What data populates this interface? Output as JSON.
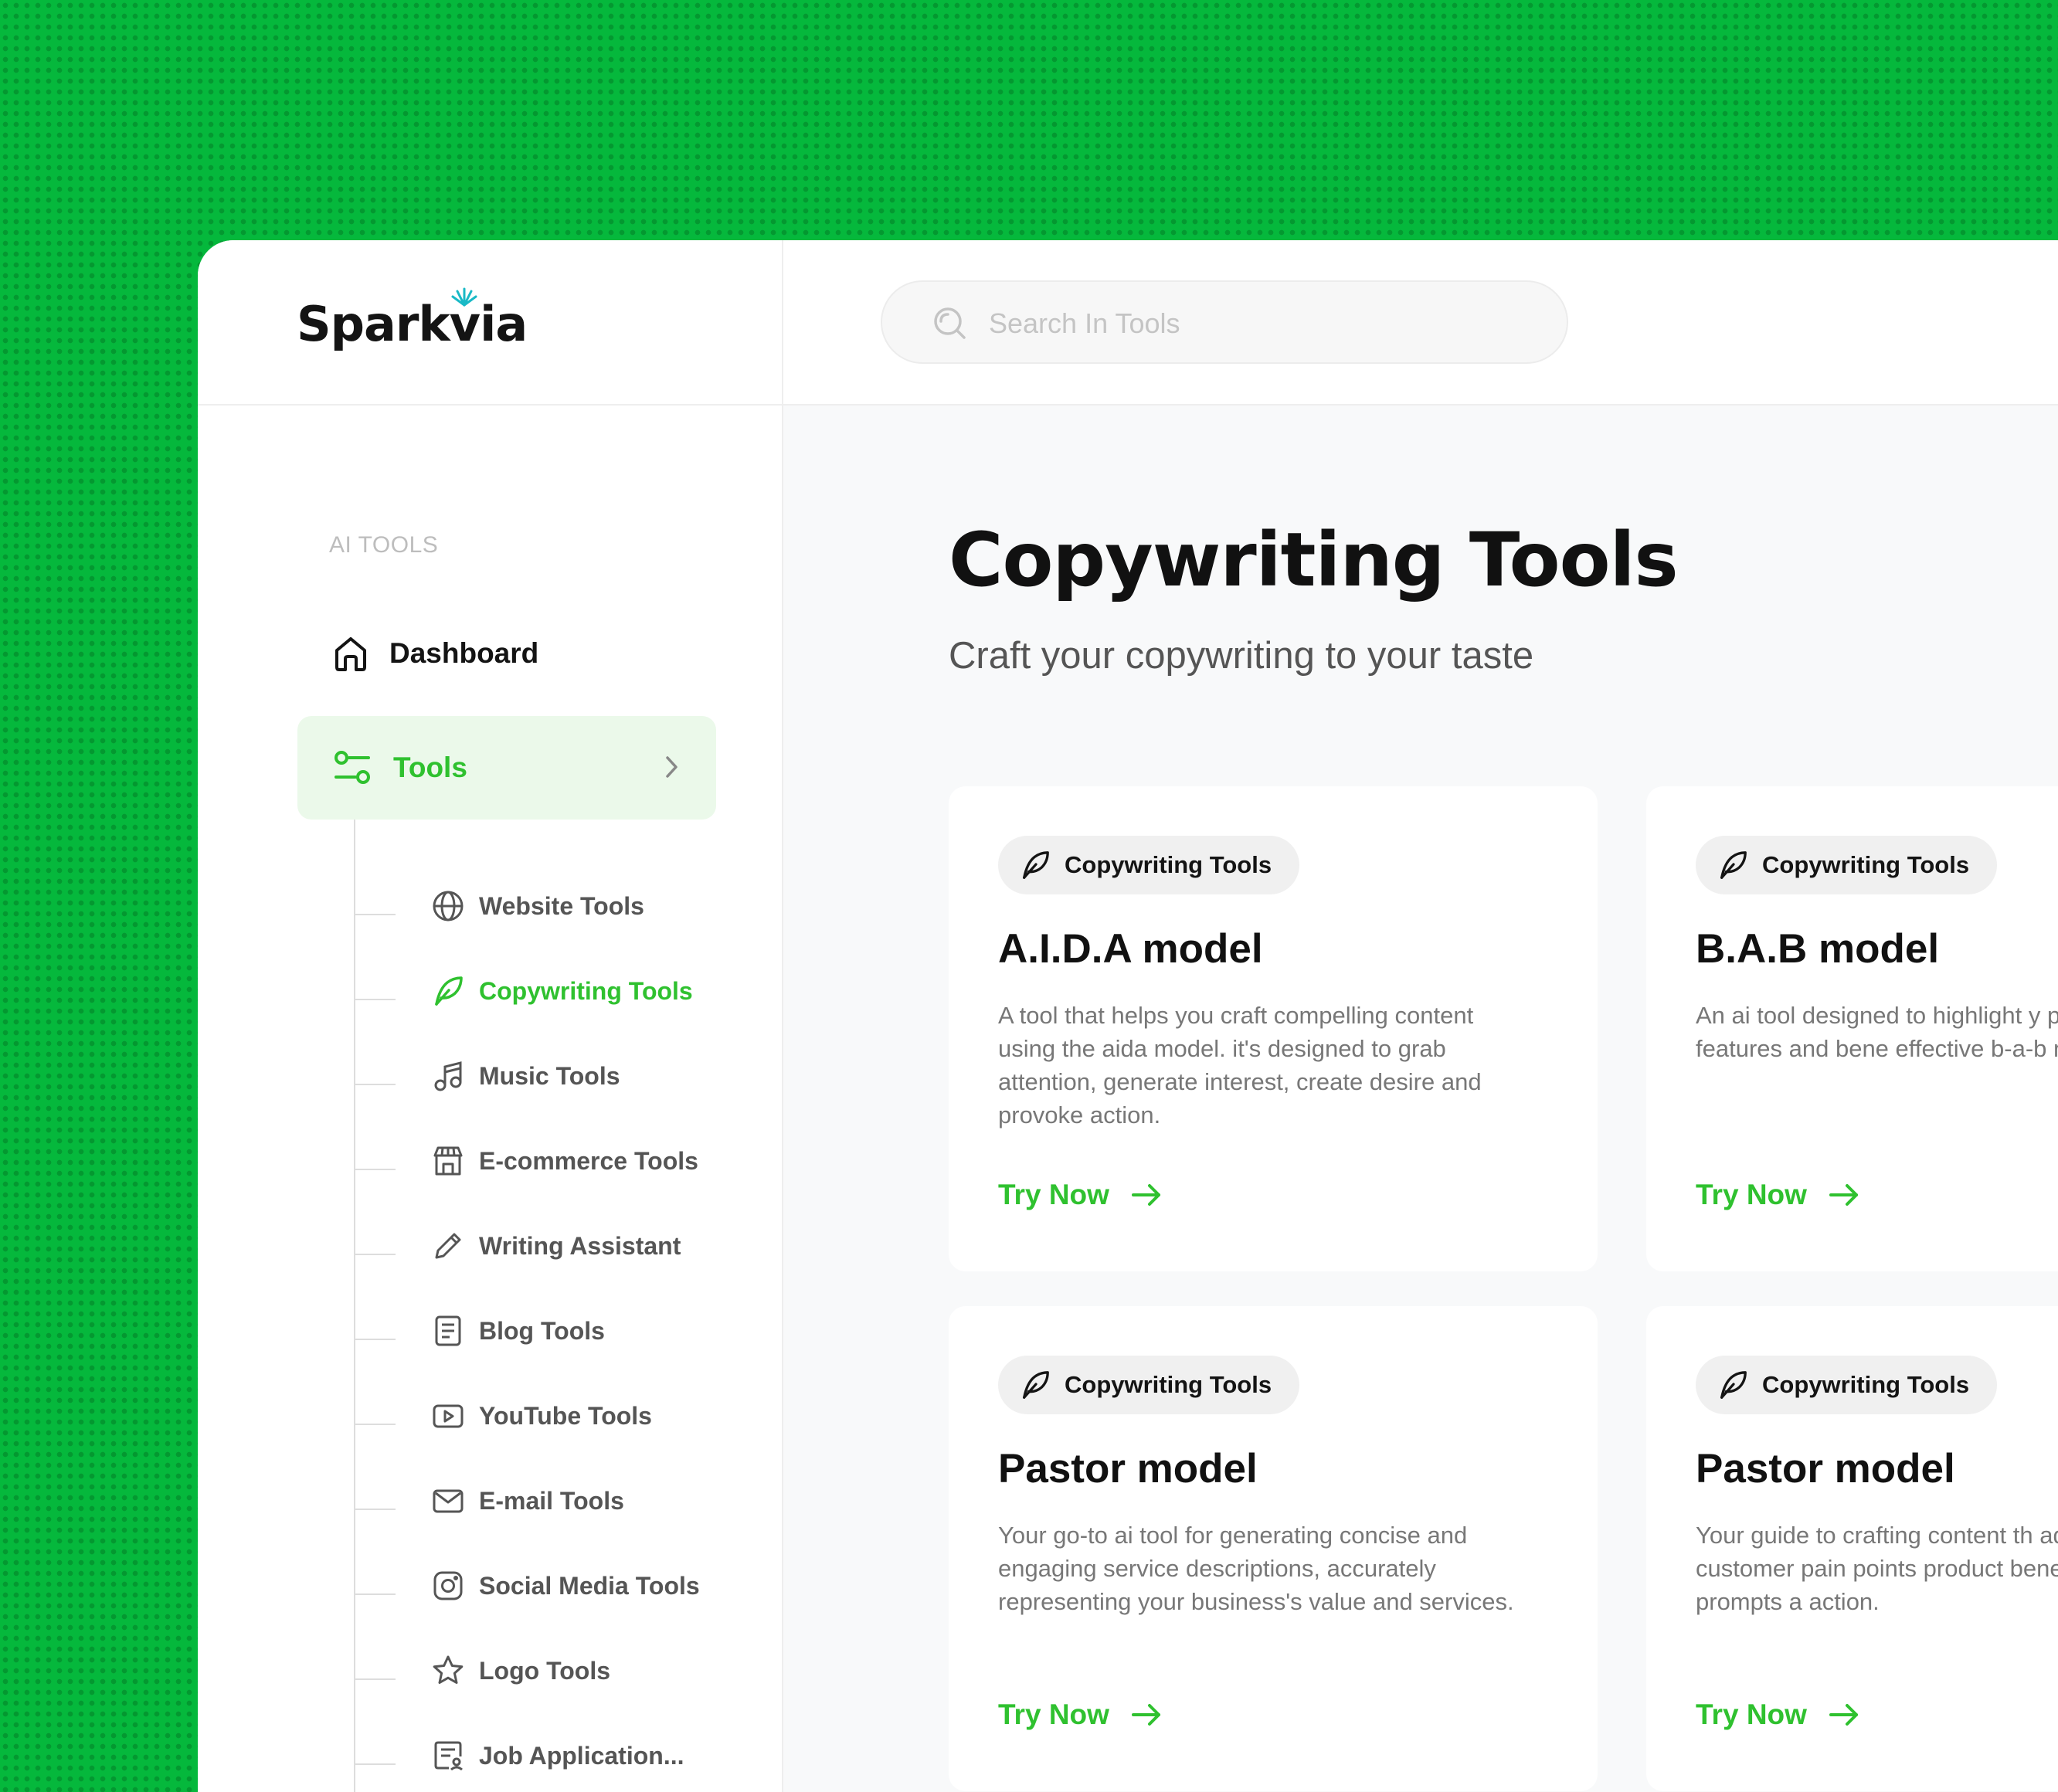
{
  "brand": {
    "name": "Sparkvia"
  },
  "search": {
    "placeholder": "Search In Tools"
  },
  "sidebar": {
    "section_label": "AI TOOLS",
    "dashboard_label": "Dashboard",
    "tools_label": "Tools",
    "sub_items": [
      {
        "label": "Website Tools",
        "icon": "globe-icon"
      },
      {
        "label": "Copywriting Tools",
        "icon": "feather-icon",
        "active": true
      },
      {
        "label": "Music Tools",
        "icon": "music-icon"
      },
      {
        "label": "E-commerce Tools",
        "icon": "store-icon"
      },
      {
        "label": "Writing Assistant",
        "icon": "pencil-icon"
      },
      {
        "label": "Blog Tools",
        "icon": "document-icon"
      },
      {
        "label": "YouTube Tools",
        "icon": "play-icon"
      },
      {
        "label": "E-mail Tools",
        "icon": "mail-icon"
      },
      {
        "label": "Social Media Tools",
        "icon": "instagram-icon"
      },
      {
        "label": "Logo Tools",
        "icon": "star-icon"
      },
      {
        "label": "Job Application...",
        "icon": "job-icon"
      }
    ]
  },
  "main": {
    "title": "Copywriting Tools",
    "subtitle": "Craft your copywriting to your taste",
    "cards": [
      {
        "badge": "Copywriting Tools",
        "title": "A.I.D.A model",
        "description": "A tool that helps you craft compelling content using the aida model. it's designed to grab attention, generate interest, create desire and provoke action.",
        "cta": "Try Now"
      },
      {
        "badge": "Copywriting Tools",
        "title": "B.A.B model",
        "description": "An ai tool designed to highlight y product's key features and bene effective b-a-b model.",
        "cta": "Try Now"
      },
      {
        "badge": "Copywriting Tools",
        "title": "Pastor model",
        "description": "Your go-to ai tool for generating concise and engaging service descriptions, accurately representing your business's value and services.",
        "cta": "Try Now"
      },
      {
        "badge": "Copywriting Tools",
        "title": "Pastor model",
        "description": "Your guide to crafting content th addresses customer pain points product benefits, and prompts a action.",
        "cta": "Try Now"
      }
    ]
  },
  "colors": {
    "accent": "#2fc12f",
    "background_green": "#05b83c",
    "active_nav_bg": "#ebf9ea"
  }
}
